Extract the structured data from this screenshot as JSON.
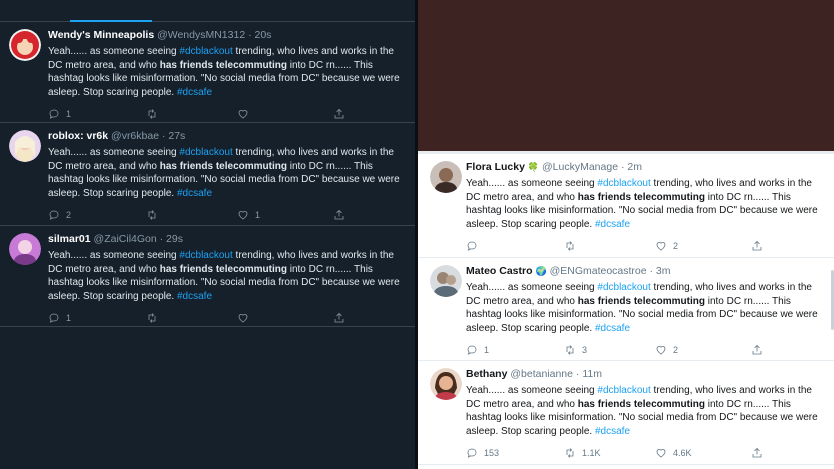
{
  "left_feed": {
    "tweets": [
      {
        "name": "Wendy's Minneapolis",
        "handle": "@WendysMN1312 · 20s",
        "text_1": "Yeah...... as someone seeing ",
        "hashtag_1": "#dcblackout",
        "text_2": " trending, who lives and works in the DC metro area, and who ",
        "bold": "has friends telecommuting",
        "text_3": " into DC rn...... This hashtag looks like misinformation. \"No social media from DC\" because we were asleep. Stop scaring people. ",
        "hashtag_2": "#dcsafe",
        "replies": "1",
        "retweets": "",
        "likes": ""
      },
      {
        "name": "roblox: vr6k",
        "handle": "@vr6kbae · 27s",
        "text_1": "Yeah...... as someone seeing ",
        "hashtag_1": "#dcblackout",
        "text_2": " trending, who lives and works in the DC metro area, and who ",
        "bold": "has friends telecommuting",
        "text_3": " into DC rn...... This hashtag looks like misinformation. \"No social media from DC\" because we were asleep. Stop scaring people. ",
        "hashtag_2": "#dcsafe",
        "replies": "2",
        "retweets": "",
        "likes": "1"
      },
      {
        "name": "silmar01",
        "handle": "@ZaiCil4Gon · 29s",
        "text_1": "Yeah...... as someone seeing ",
        "hashtag_1": "#dcblackout",
        "text_2": " trending, who lives and works in the DC metro area, and who ",
        "bold": "has friends telecommuting",
        "text_3": " into DC rn...... This hashtag looks like misinformation. \"No social media from DC\" because we were asleep. Stop scaring people. ",
        "hashtag_2": "#dcsafe",
        "replies": "1",
        "retweets": "",
        "likes": ""
      }
    ]
  },
  "right_feed": {
    "tweets": [
      {
        "name": "Flora Lucky",
        "emoji": "🍀",
        "handle": "@LuckyManage · 2m",
        "text_1": "Yeah...... as someone seeing ",
        "hashtag_1": "#dcblackout",
        "text_2": " trending, who lives and works in the DC metro area, and who ",
        "bold": "has friends telecommuting",
        "text_3": " into DC rn...... This hashtag looks like misinformation. \"No social media from DC\" because we were asleep. Stop scaring people. ",
        "hashtag_2": "#dcsafe",
        "replies": "",
        "retweets": "",
        "likes": "2"
      },
      {
        "name": "Mateo Castro",
        "emoji": "🌍",
        "handle": "@ENGmateocastroe · 3m",
        "text_1": "Yeah...... as someone seeing ",
        "hashtag_1": "#dcblackout",
        "text_2": " trending, who lives and works in the DC metro area, and who ",
        "bold": "has friends telecommuting",
        "text_3": " into DC rn...... This hashtag looks like misinformation. \"No social media from DC\" because we were asleep. Stop scaring people. ",
        "hashtag_2": "#dcsafe",
        "replies": "1",
        "retweets": "3",
        "likes": "2"
      },
      {
        "name": "Bethany",
        "emoji": "",
        "handle": "@betanianne · 11m",
        "text_1": "Yeah...... as someone seeing ",
        "hashtag_1": "#dcblackout",
        "text_2": " trending, who lives and works in the DC metro area, and who ",
        "bold": "has friends telecommuting",
        "text_3": " into DC rn...... This hashtag looks like misinformation. \"No social media from DC\" because we were asleep. Stop scaring people. ",
        "hashtag_2": "#dcsafe",
        "replies": "153",
        "retweets": "1.1K",
        "likes": "4.6K"
      }
    ]
  },
  "colors": {
    "dark_bg": "#15202b",
    "light_bg": "#ffffff",
    "accent": "#1da1f2",
    "media_block": "#3d2422"
  },
  "icons": [
    "reply-icon",
    "retweet-icon",
    "like-icon",
    "share-icon"
  ]
}
